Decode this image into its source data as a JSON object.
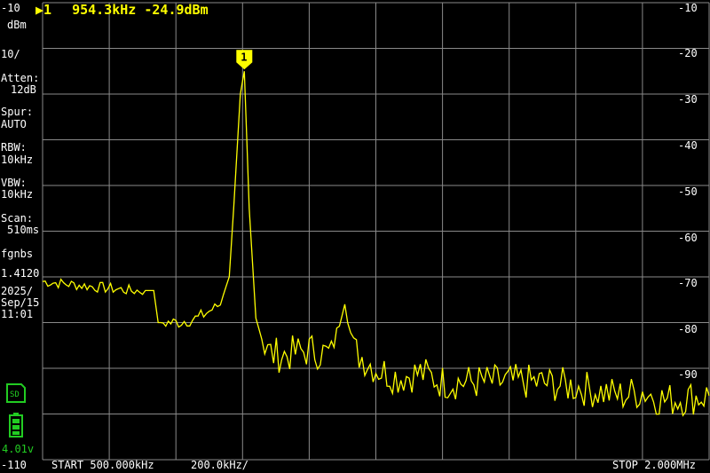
{
  "colors": {
    "trace": "#ffff00",
    "grid": "#8a8a8a",
    "text": "#ffffff",
    "battery": "#22cc22"
  },
  "marker": {
    "symbol": "▶1",
    "frequency": "954.3kHz",
    "level": "-24.9dBm",
    "badge": "1"
  },
  "left_panel": {
    "ref_level": "-10",
    "unit": "dBm",
    "scale": "10/",
    "atten_label": "Atten:",
    "atten_value": "12dB",
    "spur_label": "Spur:",
    "spur_value": "AUTO",
    "rbw_label": "RBW:",
    "rbw_value": "10kHz",
    "vbw_label": "VBW:",
    "vbw_value": "10kHz",
    "scan_label": "Scan:",
    "scan_value": "510ms",
    "user": "fgnbs",
    "version": "1.4120",
    "date_year": "2025/",
    "date_day": "Sep/15",
    "time": "11:01",
    "sd_icon": "sd-card-icon",
    "battery_icon": "battery-icon",
    "battery_voltage": "4.01v",
    "bottom_level": "-110"
  },
  "right_axis": [
    "-10",
    "-20",
    "-30",
    "-40",
    "-50",
    "-60",
    "-70",
    "-80",
    "-90"
  ],
  "footer": {
    "start": "START 500.000kHz",
    "span": "200.0kHz/",
    "stop": "STOP 2.000MHz"
  },
  "chart_data": {
    "type": "line",
    "xlabel": "",
    "ylabel": "",
    "xlim_mhz": [
      0.5,
      2.0
    ],
    "ylim_dbm": [
      -110,
      -10
    ],
    "grid": true,
    "series": [
      {
        "x_mhz": [
          0.5,
          0.6,
          0.7,
          0.75,
          0.76,
          0.8,
          0.85,
          0.9,
          0.92,
          0.93,
          0.945,
          0.954,
          0.965,
          0.98,
          1.0,
          1.02,
          1.05,
          1.1,
          1.15,
          1.18,
          1.2,
          1.25,
          1.3,
          1.35,
          1.4,
          1.5,
          1.6,
          1.7,
          1.75,
          1.8,
          1.85,
          1.9,
          2.0
        ],
        "y_dbm": [
          -71,
          -72,
          -73,
          -73,
          -80,
          -80,
          -79,
          -76,
          -70,
          -55,
          -30,
          -25,
          -55,
          -79,
          -86,
          -87,
          -87,
          -86,
          -87,
          -75,
          -86,
          -90,
          -92,
          -91,
          -93,
          -93,
          -93,
          -94,
          -95,
          -96,
          -95,
          -97,
          -96
        ]
      }
    ]
  }
}
